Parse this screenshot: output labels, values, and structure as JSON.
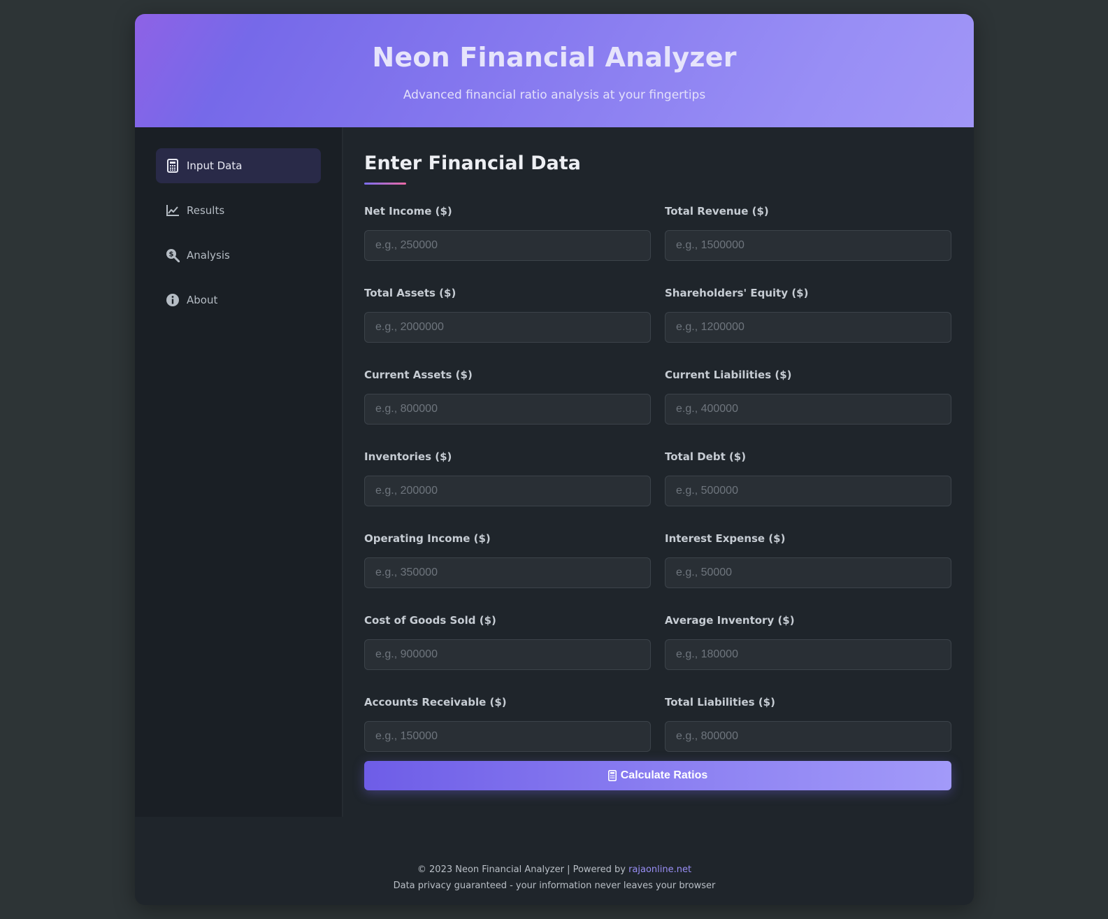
{
  "header": {
    "title": "Neon Financial Analyzer",
    "subtitle": "Advanced financial ratio analysis at your fingertips"
  },
  "sidebar": {
    "items": [
      {
        "label": "Input Data",
        "icon": "calculator-icon",
        "active": true
      },
      {
        "label": "Results",
        "icon": "chart-line-icon",
        "active": false
      },
      {
        "label": "Analysis",
        "icon": "search-dollar-icon",
        "active": false
      },
      {
        "label": "About",
        "icon": "info-circle-icon",
        "active": false
      }
    ]
  },
  "main": {
    "title": "Enter Financial Data",
    "fields": [
      {
        "label": "Net Income ($)",
        "placeholder": "e.g., 250000",
        "value": ""
      },
      {
        "label": "Total Revenue ($)",
        "placeholder": "e.g., 1500000",
        "value": ""
      },
      {
        "label": "Total Assets ($)",
        "placeholder": "e.g., 2000000",
        "value": ""
      },
      {
        "label": "Shareholders' Equity ($)",
        "placeholder": "e.g., 1200000",
        "value": ""
      },
      {
        "label": "Current Assets ($)",
        "placeholder": "e.g., 800000",
        "value": ""
      },
      {
        "label": "Current Liabilities ($)",
        "placeholder": "e.g., 400000",
        "value": ""
      },
      {
        "label": "Inventories ($)",
        "placeholder": "e.g., 200000",
        "value": ""
      },
      {
        "label": "Total Debt ($)",
        "placeholder": "e.g., 500000",
        "value": ""
      },
      {
        "label": "Operating Income ($)",
        "placeholder": "e.g., 350000",
        "value": ""
      },
      {
        "label": "Interest Expense ($)",
        "placeholder": "e.g., 50000",
        "value": ""
      },
      {
        "label": "Cost of Goods Sold ($)",
        "placeholder": "e.g., 900000",
        "value": ""
      },
      {
        "label": "Average Inventory ($)",
        "placeholder": "e.g., 180000",
        "value": ""
      },
      {
        "label": "Accounts Receivable ($)",
        "placeholder": "e.g., 150000",
        "value": ""
      },
      {
        "label": "Total Liabilities ($)",
        "placeholder": "e.g., 800000",
        "value": ""
      }
    ],
    "calculate_label": "Calculate Ratios"
  },
  "footer": {
    "line1_prefix": "© 2023 Neon Financial Analyzer | Powered by ",
    "link_text": "rajaonline.net",
    "line2": "Data privacy guaranteed - your information never leaves your browser"
  },
  "colors": {
    "background": "#2d3436",
    "panel": "#1f252b",
    "sidebar": "#1a1f25",
    "accent": "#7c6ef0",
    "header_gradient_start": "#8e62e6",
    "header_gradient_end": "#a196f7"
  }
}
